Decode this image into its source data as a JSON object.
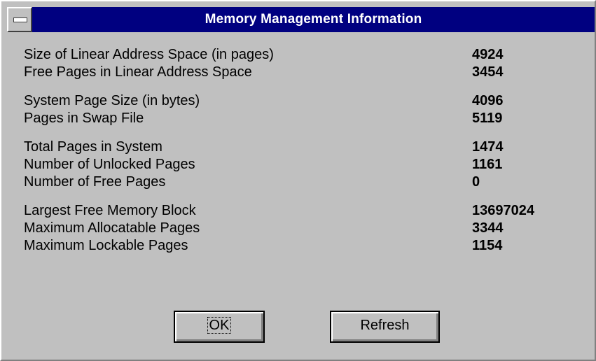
{
  "window": {
    "title": "Memory Management Information"
  },
  "groups": [
    {
      "rows": [
        {
          "label": "Size of Linear Address Space (in pages)",
          "value": "4924"
        },
        {
          "label": "Free Pages in Linear Address Space",
          "value": "3454"
        }
      ]
    },
    {
      "rows": [
        {
          "label": "System Page Size (in bytes)",
          "value": "4096"
        },
        {
          "label": "Pages in Swap File",
          "value": "5119"
        }
      ]
    },
    {
      "rows": [
        {
          "label": "Total Pages in System",
          "value": "1474"
        },
        {
          "label": "Number of Unlocked Pages",
          "value": "1161"
        },
        {
          "label": "Number of Free Pages",
          "value": "0"
        }
      ]
    },
    {
      "rows": [
        {
          "label": "Largest Free Memory Block",
          "value": "13697024"
        },
        {
          "label": "Maximum Allocatable Pages",
          "value": "3344"
        },
        {
          "label": "Maximum Lockable Pages",
          "value": "1154"
        }
      ]
    }
  ],
  "buttons": {
    "ok_label": "OK",
    "refresh_label": "Refresh"
  },
  "icons": {
    "system_menu": "system-menu-icon"
  },
  "colors": {
    "title_bar": "#000080",
    "dialog_face": "#c0c0c0"
  }
}
